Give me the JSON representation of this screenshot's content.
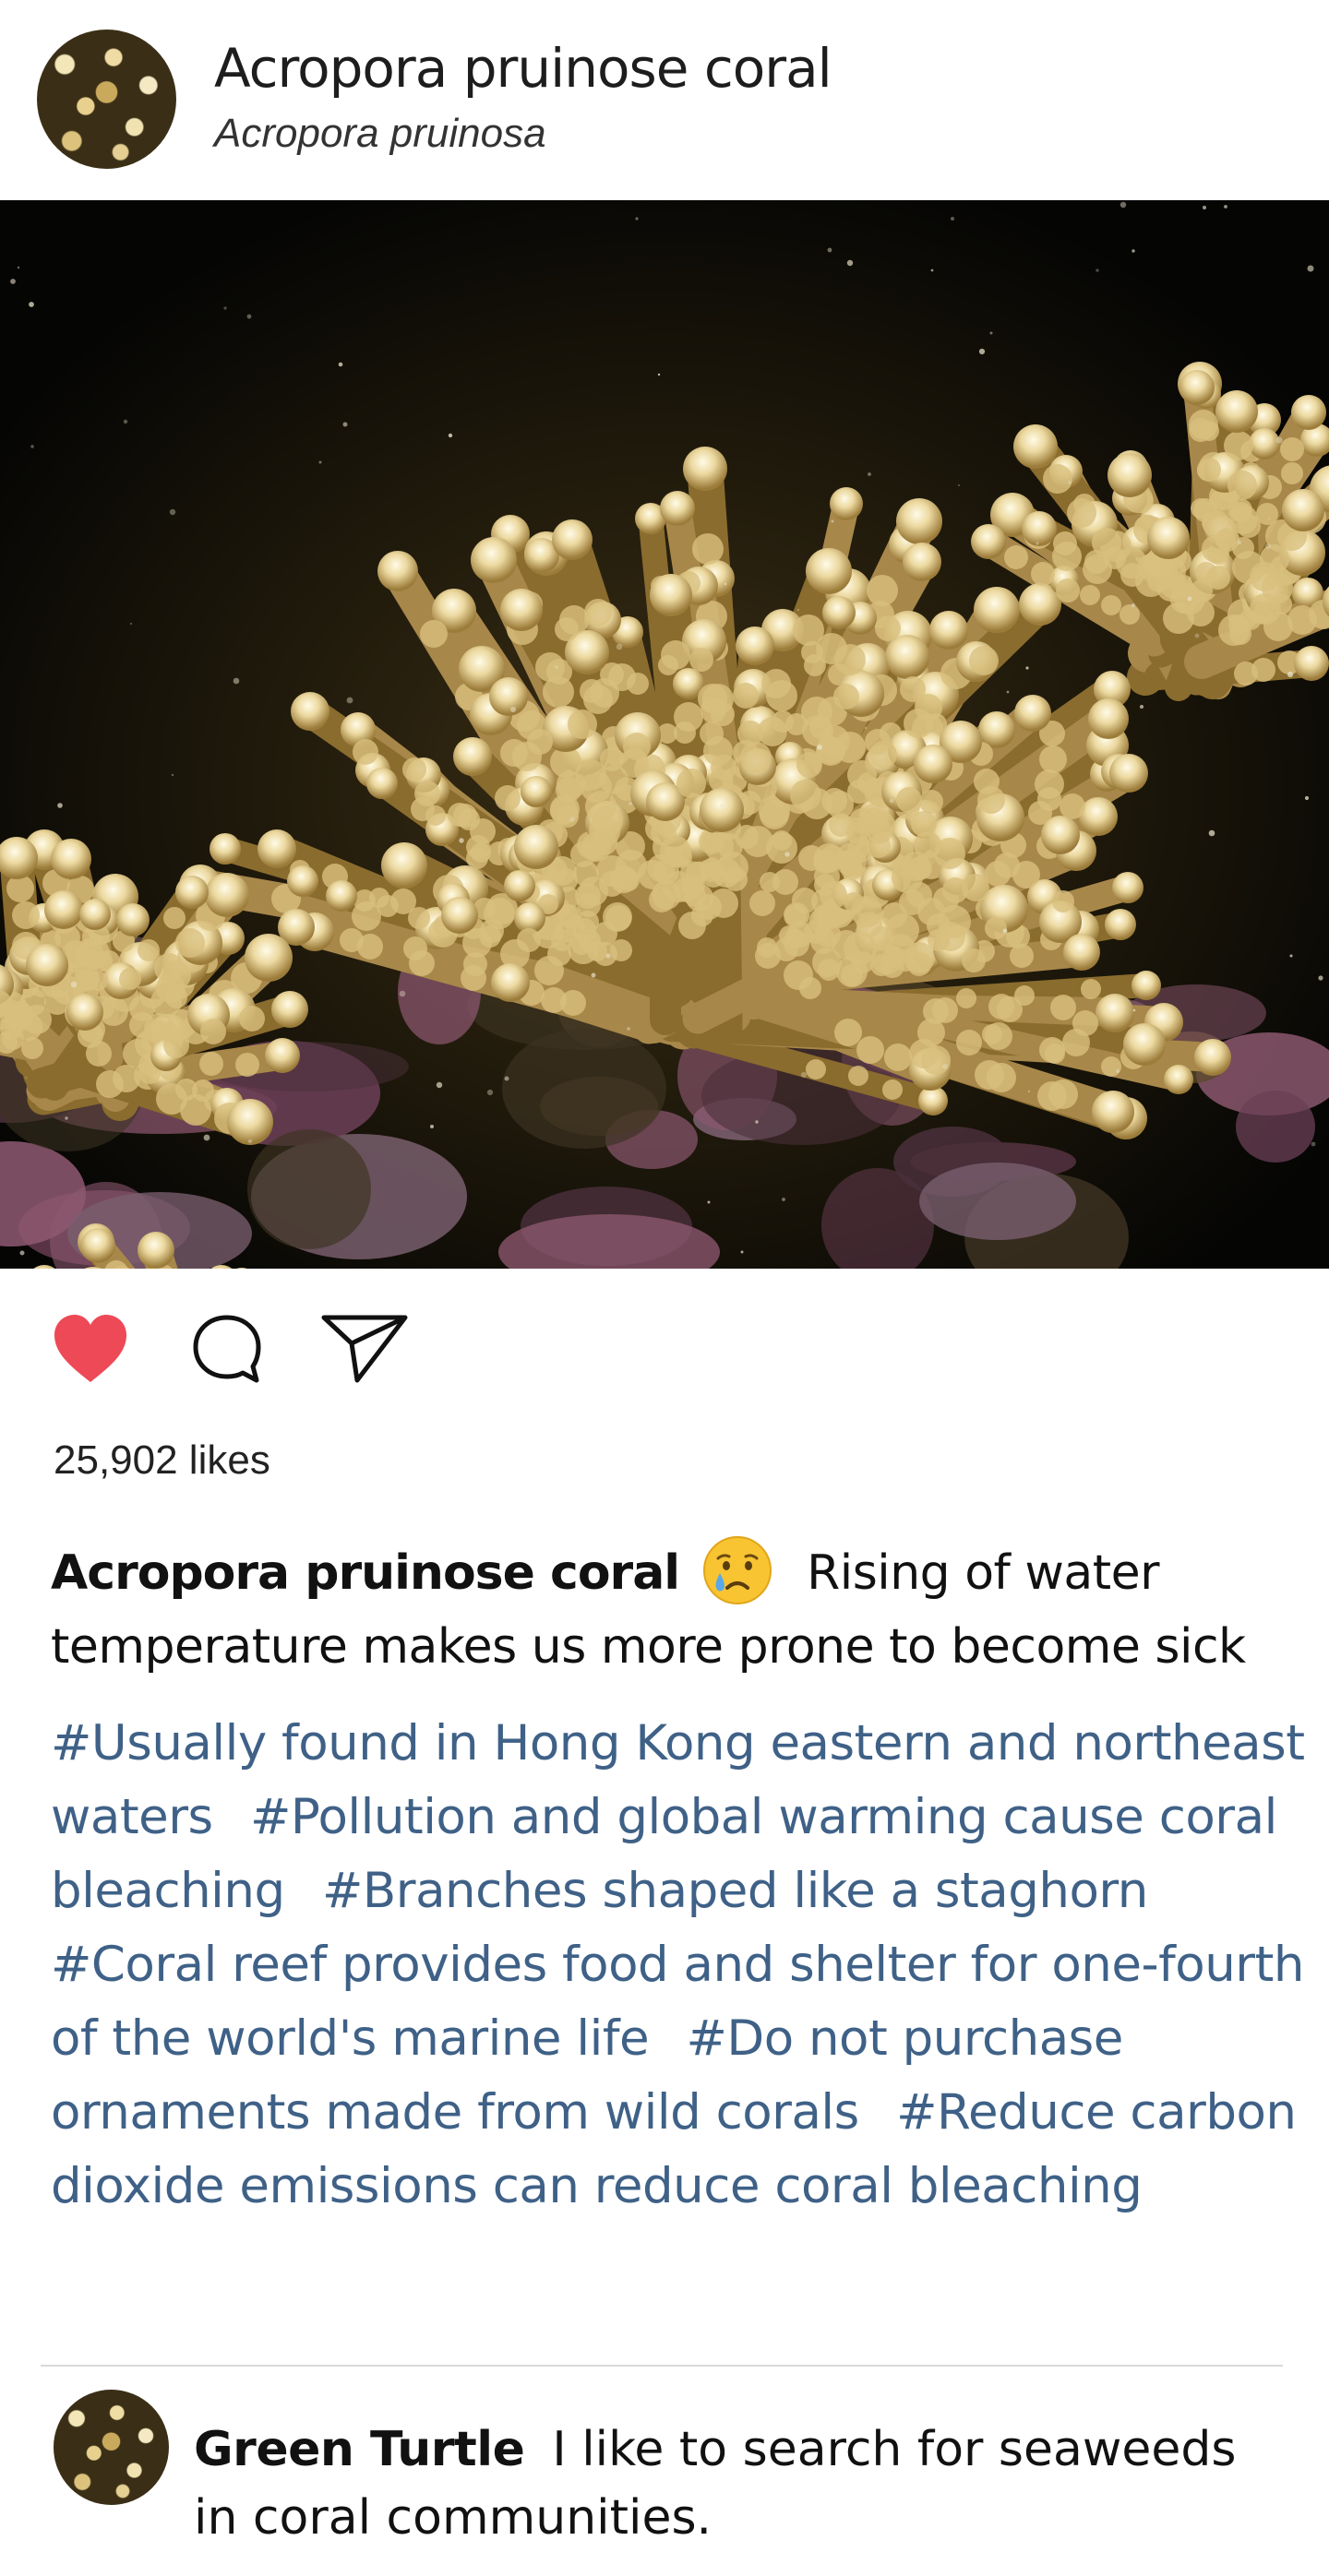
{
  "header": {
    "title": "Acropora pruinose coral",
    "subtitle": "Acropora pruinosa",
    "avatar_icon": "coral-avatar"
  },
  "photo": {
    "subject": "coral-photo"
  },
  "actions": {
    "like_icon": "heart-icon",
    "like_color": "#ed4956",
    "comment_icon": "comment-bubble-icon",
    "share_icon": "paper-plane-icon",
    "liked": true
  },
  "likes": {
    "label": "25,902 likes"
  },
  "caption": {
    "username": "Acropora pruinose coral",
    "emoji_icon": "crying-face-icon",
    "text": "Rising of water temperature  makes us more prone to become sick"
  },
  "hashtags": [
    "#Usually found in Hong Kong eastern and northeast waters",
    "#Pollution and global warming cause coral bleaching",
    "#Branches shaped like a staghorn",
    "#Coral reef provides food and shelter for one-fourth of the world's marine life",
    "#Do not purchase ornaments made from wild corals",
    "#Reduce carbon dioxide emissions can reduce coral bleaching"
  ],
  "hashtag_color": "#3f6187",
  "comment": {
    "username": "Green Turtle",
    "text": "I like to search for seaweeds in coral communities.",
    "avatar_icon": "coral-avatar"
  }
}
